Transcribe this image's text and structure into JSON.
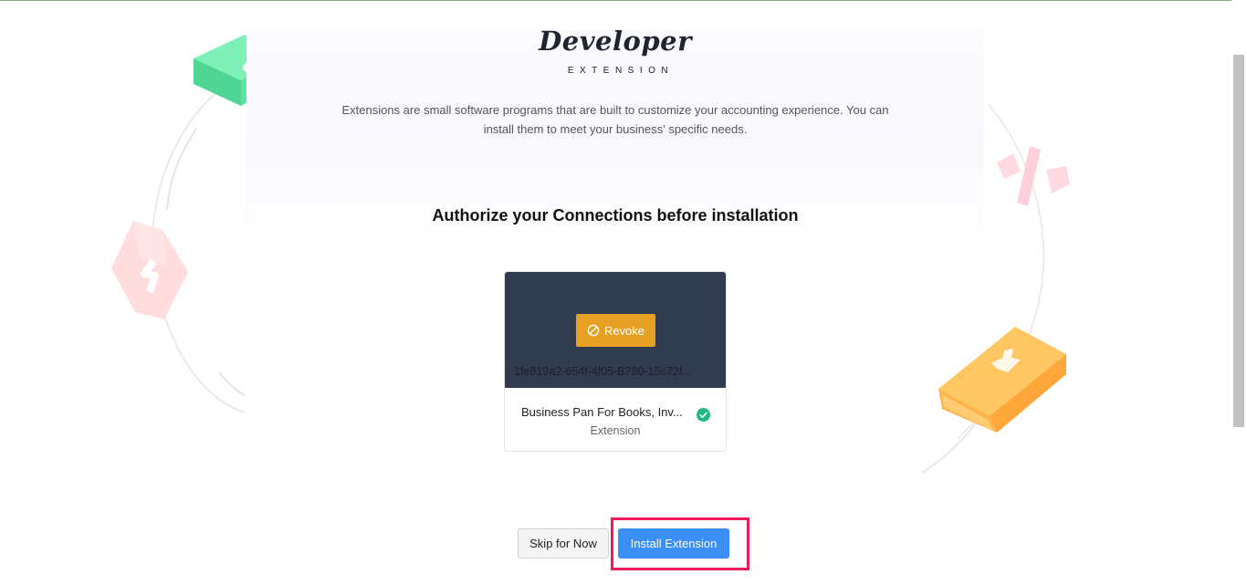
{
  "brand": {
    "title": "Developer",
    "subtitle": "EXTENSION"
  },
  "hero": {
    "description_line1": "Extensions are small software programs that are built to customize your accounting experience. You can",
    "description_line2": "install them to meet your business' specific needs."
  },
  "section": {
    "heading": "Authorize your Connections before installation"
  },
  "connection_card": {
    "revoke_label": "Revoke",
    "connection_id": "1fe819a2-654f-4f05-B780-15c72f...",
    "name": "Business Pan For Books, Inv...",
    "type": "Extension"
  },
  "actions": {
    "skip_label": "Skip for Now",
    "install_label": "Install Extension"
  },
  "colors": {
    "revoke": "#e6a023",
    "install": "#3a8ef6",
    "card_header": "#323c50",
    "highlight": "#ee1a59",
    "verified": "#1fb87f"
  }
}
